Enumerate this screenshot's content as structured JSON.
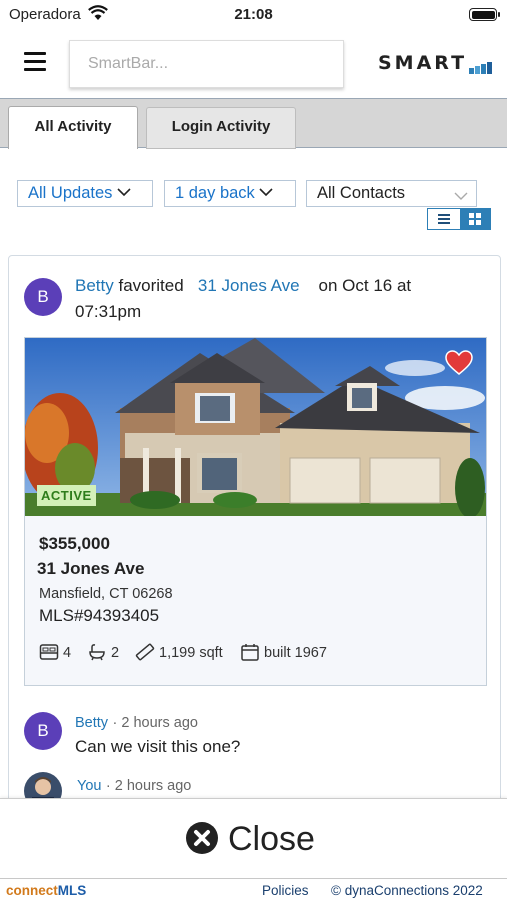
{
  "status_bar": {
    "carrier": "Operadora",
    "time": "21:08"
  },
  "header": {
    "search_placeholder": "SmartBar...",
    "logo_text": "SMART"
  },
  "tabs": [
    {
      "label": "All Activity",
      "active": true
    },
    {
      "label": "Login Activity",
      "active": false
    }
  ],
  "filters": {
    "updates": "All Updates",
    "time_range": "1 day back",
    "contacts": "All Contacts"
  },
  "activity": {
    "avatar_initial": "B",
    "user": "Betty",
    "action": "favorited",
    "property_link": "31 Jones Ave",
    "when": "on Oct 16 at 07:31pm"
  },
  "listing": {
    "status": "ACTIVE",
    "price": "$355,000",
    "address": "31 Jones Ave",
    "city": "Mansfield, CT 06268",
    "mls_label": "MLS#",
    "mls_number": "94393405",
    "beds": "4",
    "baths": "2",
    "sqft": "1,199 sqft",
    "built": "built 1967",
    "favorited": true
  },
  "comments": [
    {
      "avatar_initial": "B",
      "name": "Betty",
      "time": "· 2 hours ago",
      "text": "Can we visit this one?"
    },
    {
      "name": "You",
      "time": "· 2 hours ago",
      "text": ""
    }
  ],
  "close_label": "Close",
  "footer": {
    "brand_a": "connect",
    "brand_b": "MLS",
    "policies": "Policies",
    "copyright": "© dynaConnections 2022"
  },
  "colors": {
    "accent": "#2176b5",
    "avatar": "#5b3fb8",
    "active_badge": "#d3f0b8",
    "heart": "#e23a3a"
  }
}
